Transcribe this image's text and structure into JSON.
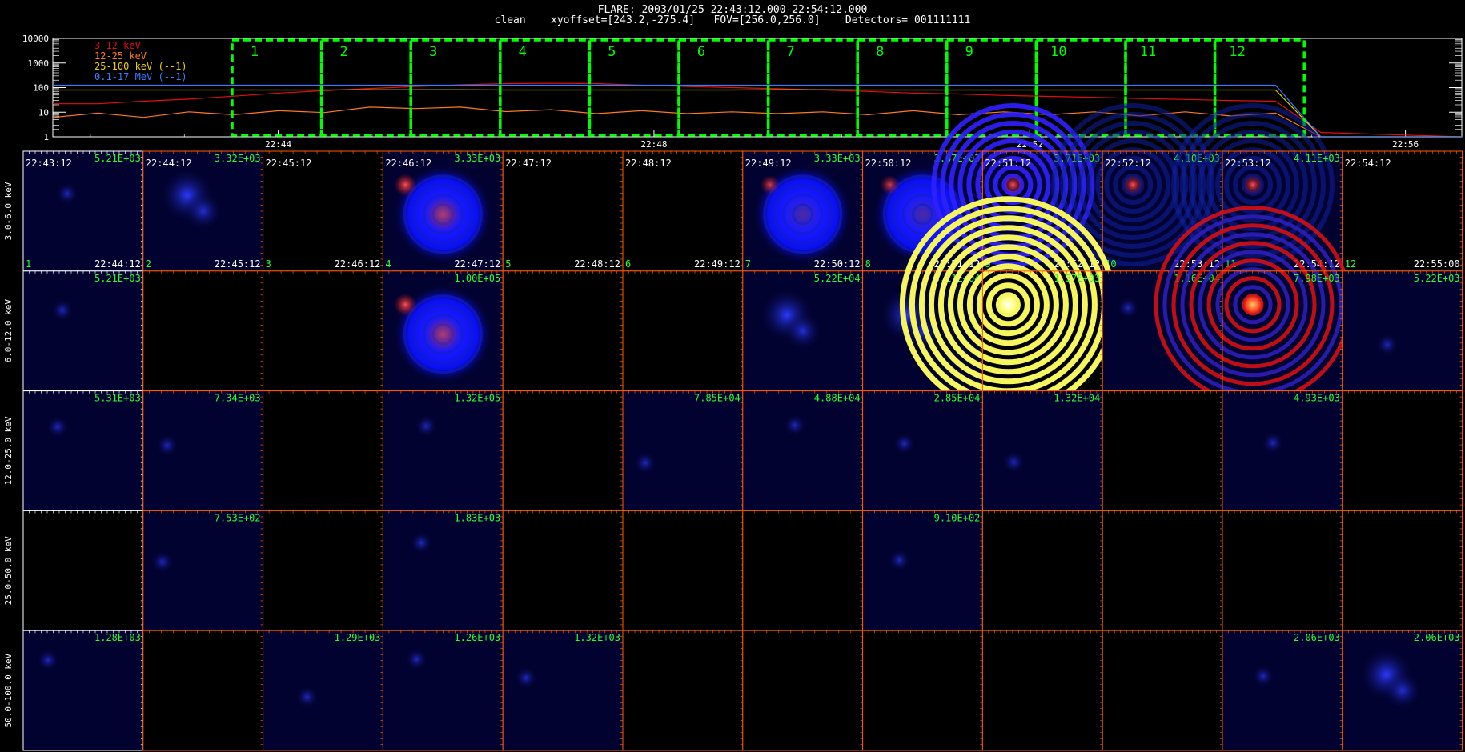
{
  "header": {
    "title": "FLARE: 2003/01/25 22:43:12.000-22:54:12.000",
    "subtitle": "clean    xyoffset=[243.2,-275.4]   FOV=[256.0,256.0]    Detectors= 001111111"
  },
  "colors": {
    "background": "#000000",
    "grid_frame": "#ff5a00",
    "grid_frame_first": "#ffffff",
    "window_box": "#00ff00",
    "label_green": "#2bff2b",
    "image_blue": "#0000ff",
    "image_dark_blue": "#020230",
    "image_red": "#e01010",
    "image_yellow": "#f5f560",
    "image_orange": "#ff7a1a"
  },
  "chart_data": {
    "type": "line",
    "title": "",
    "yscale": "log",
    "ylim": [
      1,
      10000
    ],
    "y_ticks": [
      "10000",
      "1000",
      "100",
      "10",
      "1"
    ],
    "x_ticks": [
      "22:44",
      "22:48",
      "22:52",
      "22:56"
    ],
    "legend_position": "top-left",
    "series": [
      {
        "name": "3-12 keV",
        "color": "#e01010",
        "values": [
          22,
          22,
          28,
          34,
          45,
          60,
          75,
          92,
          110,
          130,
          145,
          150,
          145,
          125,
          110,
          100,
          90,
          80,
          70,
          60,
          55,
          48,
          44,
          40,
          36,
          33,
          30,
          28,
          1.5
        ]
      },
      {
        "name": "12-25 keV",
        "color": "#ff7a1a",
        "values": [
          7,
          8,
          7,
          9,
          9,
          10,
          11,
          14,
          16,
          14,
          12,
          11,
          10,
          10,
          10,
          9,
          10,
          9,
          9,
          10,
          9,
          9,
          9,
          9,
          8,
          9,
          8,
          8,
          1
        ]
      },
      {
        "name": "25-100 keV (--1)",
        "color": "#f0d000",
        "values": [
          80,
          80,
          80,
          80,
          80,
          80,
          80,
          82,
          82,
          82,
          80,
          80,
          80,
          80,
          80,
          80,
          82,
          82,
          80,
          80,
          80,
          80,
          80,
          80,
          80,
          80,
          80,
          80,
          1
        ]
      },
      {
        "name": "0.1-17 MeV (--1)",
        "color": "#3a7cff",
        "values": [
          125,
          125,
          125,
          125,
          125,
          125,
          125,
          125,
          125,
          125,
          125,
          125,
          125,
          125,
          125,
          125,
          125,
          125,
          125,
          125,
          125,
          125,
          125,
          125,
          125,
          125,
          125,
          125,
          1
        ]
      }
    ],
    "windows": [
      "1",
      "2",
      "3",
      "4",
      "5",
      "6",
      "7",
      "8",
      "9",
      "10",
      "11",
      "12"
    ]
  },
  "image_grid": {
    "energy_bands": [
      "3.0-6.0 keV",
      "6.0-12.0 keV",
      "12.0-25.0 keV",
      "25.0-50.0 keV",
      "50.0-100.0 keV"
    ],
    "start_times": [
      "22:43:12",
      "22:44:12",
      "22:45:12",
      "22:46:12",
      "22:47:12",
      "22:48:12",
      "22:49:12",
      "22:50:12",
      "22:51:12",
      "22:52:12",
      "22:53:12",
      "22:54:12"
    ],
    "end_times": [
      "22:44:12",
      "22:45:12",
      "22:46:12",
      "22:47:12",
      "22:48:12",
      "22:49:12",
      "22:50:12",
      "22:51:12",
      "22:52:12",
      "22:53:12",
      "22:54:12",
      "22:55:00"
    ],
    "indices": [
      "1",
      "2",
      "3",
      "4",
      "5",
      "6",
      "7",
      "8",
      "9",
      "10",
      "11",
      "12"
    ],
    "rows": [
      {
        "maxima": [
          "5.21E+03",
          "3.32E+03",
          "",
          "3.33E+03",
          "",
          "",
          "3.33E+03",
          "3.67E+03",
          "3.71E+03",
          "4.10E+03",
          "4.11E+03",
          ""
        ],
        "kinds": [
          "dimblue",
          "blob",
          "empty",
          "bigred",
          "empty",
          "empty",
          "big",
          "big",
          "rings",
          "ringsdim",
          "ringsdim",
          "empty"
        ]
      },
      {
        "maxima": [
          "5.21E+03",
          "",
          "",
          "1.00E+05",
          "",
          "",
          "5.22E+04",
          "3.11E+04",
          "1.37E+03",
          "1.16E+04",
          "7.98E+03",
          "5.22E+03"
        ],
        "kinds": [
          "dimblue",
          "empty",
          "empty",
          "bigred",
          "empty",
          "empty",
          "blob",
          "blob",
          "yellow",
          "dimblue",
          "redrings",
          "dimblue"
        ]
      },
      {
        "maxima": [
          "5.31E+03",
          "7.34E+03",
          "",
          "1.32E+05",
          "",
          "7.85E+04",
          "4.88E+04",
          "2.85E+04",
          "1.32E+04",
          "",
          "4.93E+03",
          ""
        ],
        "kinds": [
          "dimblue",
          "dimblue",
          "empty",
          "dimblue",
          "empty",
          "dimblue",
          "dimblue",
          "dimblue",
          "dimblue",
          "empty",
          "dimblue",
          "empty"
        ]
      },
      {
        "maxima": [
          "",
          "7.53E+02",
          "",
          "1.83E+03",
          "",
          "",
          "",
          "9.10E+02",
          "",
          "",
          "",
          ""
        ],
        "kinds": [
          "empty",
          "dimblue",
          "empty",
          "dimblue",
          "empty",
          "empty",
          "empty",
          "dimblue",
          "empty",
          "empty",
          "empty",
          "empty"
        ]
      },
      {
        "maxima": [
          "1.28E+03",
          "",
          "1.29E+03",
          "1.26E+03",
          "1.32E+03",
          "",
          "",
          "",
          "",
          "",
          "2.06E+03",
          "2.06E+03"
        ],
        "kinds": [
          "dimblue",
          "empty",
          "dimblue",
          "dimblue",
          "dimblue",
          "empty",
          "empty",
          "empty",
          "empty",
          "empty",
          "dimblue",
          "blob"
        ]
      }
    ]
  }
}
